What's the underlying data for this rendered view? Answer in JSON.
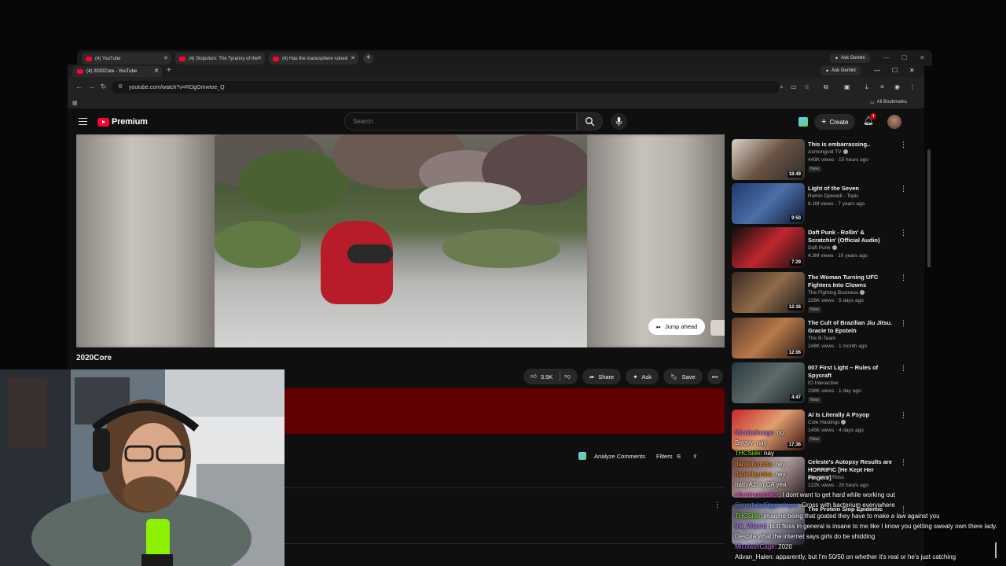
{
  "background_window": {
    "tabs": [
      {
        "title": "(4) YouTube"
      },
      {
        "title": "(4) Slopulism: The Tyranny of the"
      },
      {
        "title": "(4) Has the manosphere ruined"
      }
    ],
    "ask_gemini": "Ask Gemini"
  },
  "browser": {
    "tab_title": "(4) 2020Core - YouTube",
    "ask_gemini": "Ask Gemini",
    "url": "youtube.com/watch?v=ROgOmwtoe_Q",
    "all_bookmarks": "All Bookmarks"
  },
  "youtube": {
    "logo_text": "Premium",
    "search_placeholder": "Search",
    "create_label": "Create",
    "notification_count": "4",
    "video_title": "2020Core",
    "jump_ahead": "Jump ahead",
    "actions": {
      "likes": "3.5K",
      "share": "Share",
      "ask": "Ask",
      "save": "Save"
    },
    "analyze_comments": "Analyze Comments",
    "filters": "Filters"
  },
  "sidebar": {
    "items": [
      {
        "title": "This is embarrassing..",
        "channel": "Asmongold TV",
        "verified": true,
        "meta": "443K views · 15 hours ago",
        "badge": "New",
        "duration": "18:49",
        "colors": [
          "#d9d2c6",
          "#6b5444",
          "#2c2b2a"
        ]
      },
      {
        "title": "Light of the Seven",
        "channel": "Ramin Djawadi - Topic",
        "verified": false,
        "meta": "6.1M views · 7 years ago",
        "badge": "",
        "duration": "9:50",
        "colors": [
          "#1f3a6b",
          "#4b6fa8",
          "#0c1830"
        ]
      },
      {
        "title": "Daft Punk - Rollin' & Scratchin' (Official Audio)",
        "channel": "Daft Punk",
        "verified": true,
        "meta": "4.3M views · 10 years ago",
        "badge": "",
        "duration": "7:29",
        "colors": [
          "#0d0d0d",
          "#c0262f",
          "#111"
        ]
      },
      {
        "title": "The Woman Turning UFC Fighters Into Clowns",
        "channel": "The Fighting Business",
        "verified": true,
        "meta": "226K views · 5 days ago",
        "badge": "New",
        "duration": "12:16",
        "colors": [
          "#3b2a22",
          "#8f6a4a",
          "#1a1a1a"
        ]
      },
      {
        "title": "The Cult of Brazilian Jiu Jitsu. Gracie to Epstein",
        "channel": "The B-Team",
        "verified": false,
        "meta": "248K views · 1 month ago",
        "badge": "",
        "duration": "12:06",
        "colors": [
          "#5a3a2a",
          "#b87a4a",
          "#2a1a14"
        ]
      },
      {
        "title": "007 First Light – Rules of Spycraft",
        "channel": "IO Interactive",
        "verified": false,
        "meta": "238K views · 1 day ago",
        "badge": "New",
        "duration": "4:47",
        "colors": [
          "#2b3a3e",
          "#5c6a6a",
          "#1a2224"
        ]
      },
      {
        "title": "AI Is Literally A Psyop",
        "channel": "Cole Hastings",
        "verified": true,
        "meta": "145K views · 4 days ago",
        "badge": "New",
        "duration": "17:36",
        "colors": [
          "#c8262a",
          "#e0a070",
          "#3a1010"
        ]
      },
      {
        "title": "Celeste's Autopsy Results are HORRIFIC [He Kept Her Fingers]",
        "channel": "Trap Mom Ross",
        "verified": false,
        "meta": "122K views · 20 hours ago",
        "badge": "",
        "duration": "",
        "colors": [
          "#6a3a3a",
          "#b0a0a0",
          "#2a1a1a"
        ]
      },
      {
        "title": "The Protein Slop Epidemic",
        "channel": "",
        "verified": false,
        "meta": "",
        "badge": "",
        "duration": "",
        "colors": [
          "#4a4a5a",
          "#a0a0b0",
          "#1a1a2a"
        ]
      }
    ]
  },
  "chat": [
    {
      "user": "Micolashcage",
      "text": "no",
      "color": "#c77dff"
    },
    {
      "user": "Brrgyy",
      "text": "nay",
      "color": "#ffffff"
    },
    {
      "user": "THCSide",
      "text": "nay",
      "color": "#7cfc00"
    },
    {
      "user": "danieltsymba",
      "text": "ney",
      "color": "#ff9900"
    },
    {
      "user": "danieltsymba",
      "text": "ney",
      "color": "#ff9900"
    },
    {
      "user": "nattyAJ",
      "text": "in CA yea",
      "color": "#ffffff"
    },
    {
      "user": "vibratingweaker",
      "text": "I dont want to get hard while working out",
      "color": "#ff4fd8"
    },
    {
      "user": "Sirnortalad0ggerslayer",
      "text": "Gross with bacterium everywhere",
      "color": "#5b8cff"
    },
    {
      "user": "THCSide",
      "text": "imagine being that goated they have to make a law against you",
      "color": "#7cfc00"
    },
    {
      "user": "Ink_Wizard",
      "text": "butt floss in general is insane to me like I know you getting sweaty own there lady. Despite what the internet says girls do be shidding",
      "color": "#c77dff"
    },
    {
      "user": "MicolashCage",
      "text": "2020",
      "color": "#c77dff"
    },
    {
      "user": "Ativan_Halen",
      "text": "apparently, but I'm 50/50 on whether it's real or he's just catching",
      "color": "#ffffff"
    }
  ]
}
